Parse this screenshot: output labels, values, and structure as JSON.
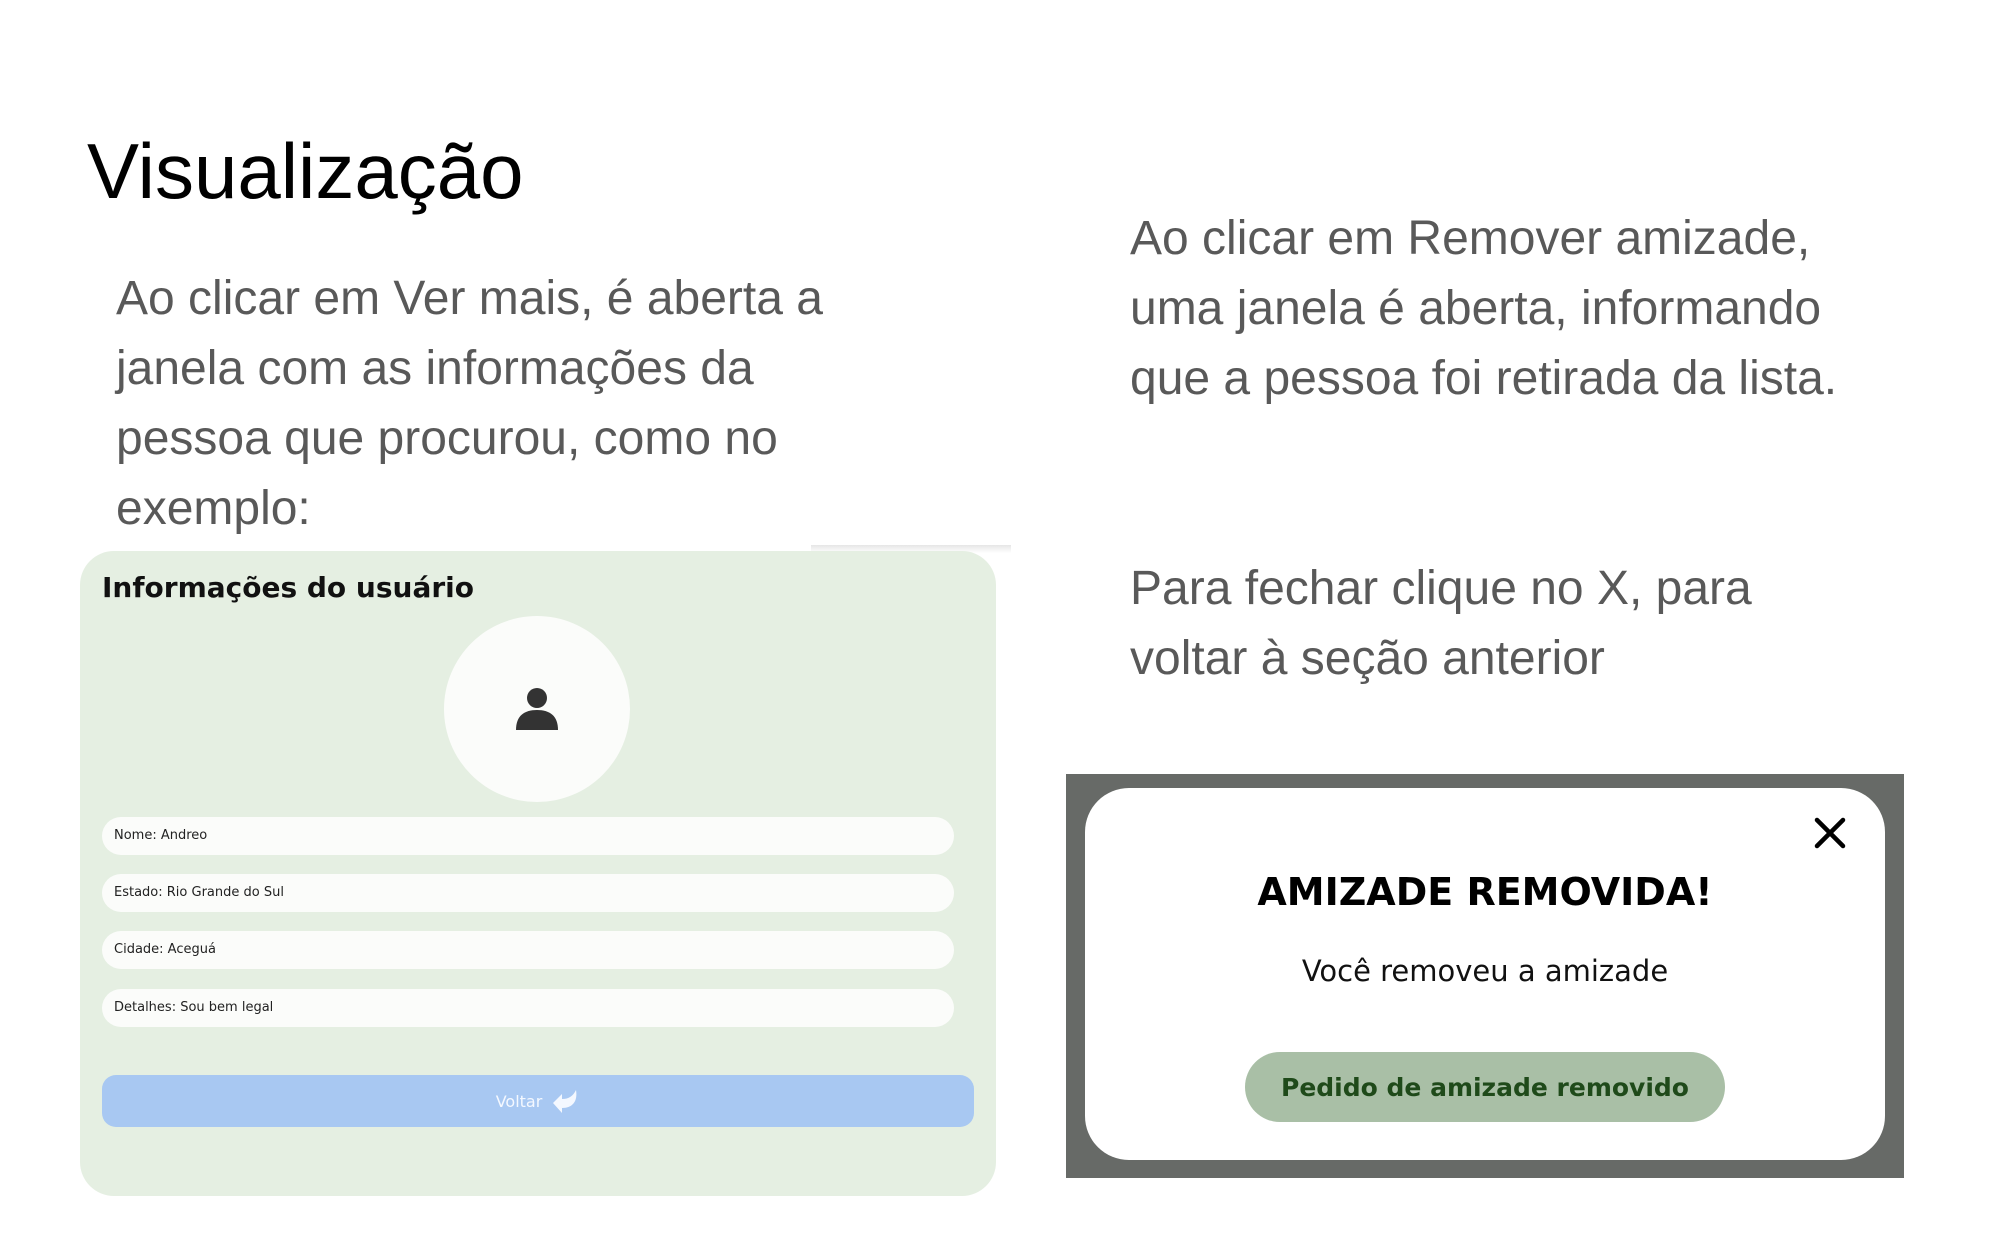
{
  "slide": {
    "title": "Visualização",
    "left_text": "Ao clicar em Ver mais, é aberta a janela com as informações da pessoa que procurou, como no exemplo:",
    "right_text_1": "Ao clicar em Remover amizade, uma janela é aberta, informando que a pessoa foi retirada da lista.",
    "right_text_2": "Para fechar clique no X, para voltar à seção anterior"
  },
  "user_info": {
    "title": "Informações do usuário",
    "fields": [
      "Nome: Andreo",
      "Estado: Rio Grande do Sul",
      "Cidade: Aceguá",
      "Detalhes: Sou bem legal"
    ],
    "back_label": "Voltar"
  },
  "dialog": {
    "title": "AMIZADE REMOVIDA!",
    "message": "Você removeu a amizade",
    "button_label": "Pedido de amizade removido"
  },
  "colors": {
    "card_bg": "#e5efe2",
    "back_button": "#a8c8f2",
    "overlay": "#676a67",
    "removed_button": "#a9bfa6",
    "removed_button_text": "#1f4a1a",
    "body_text": "#595959"
  }
}
